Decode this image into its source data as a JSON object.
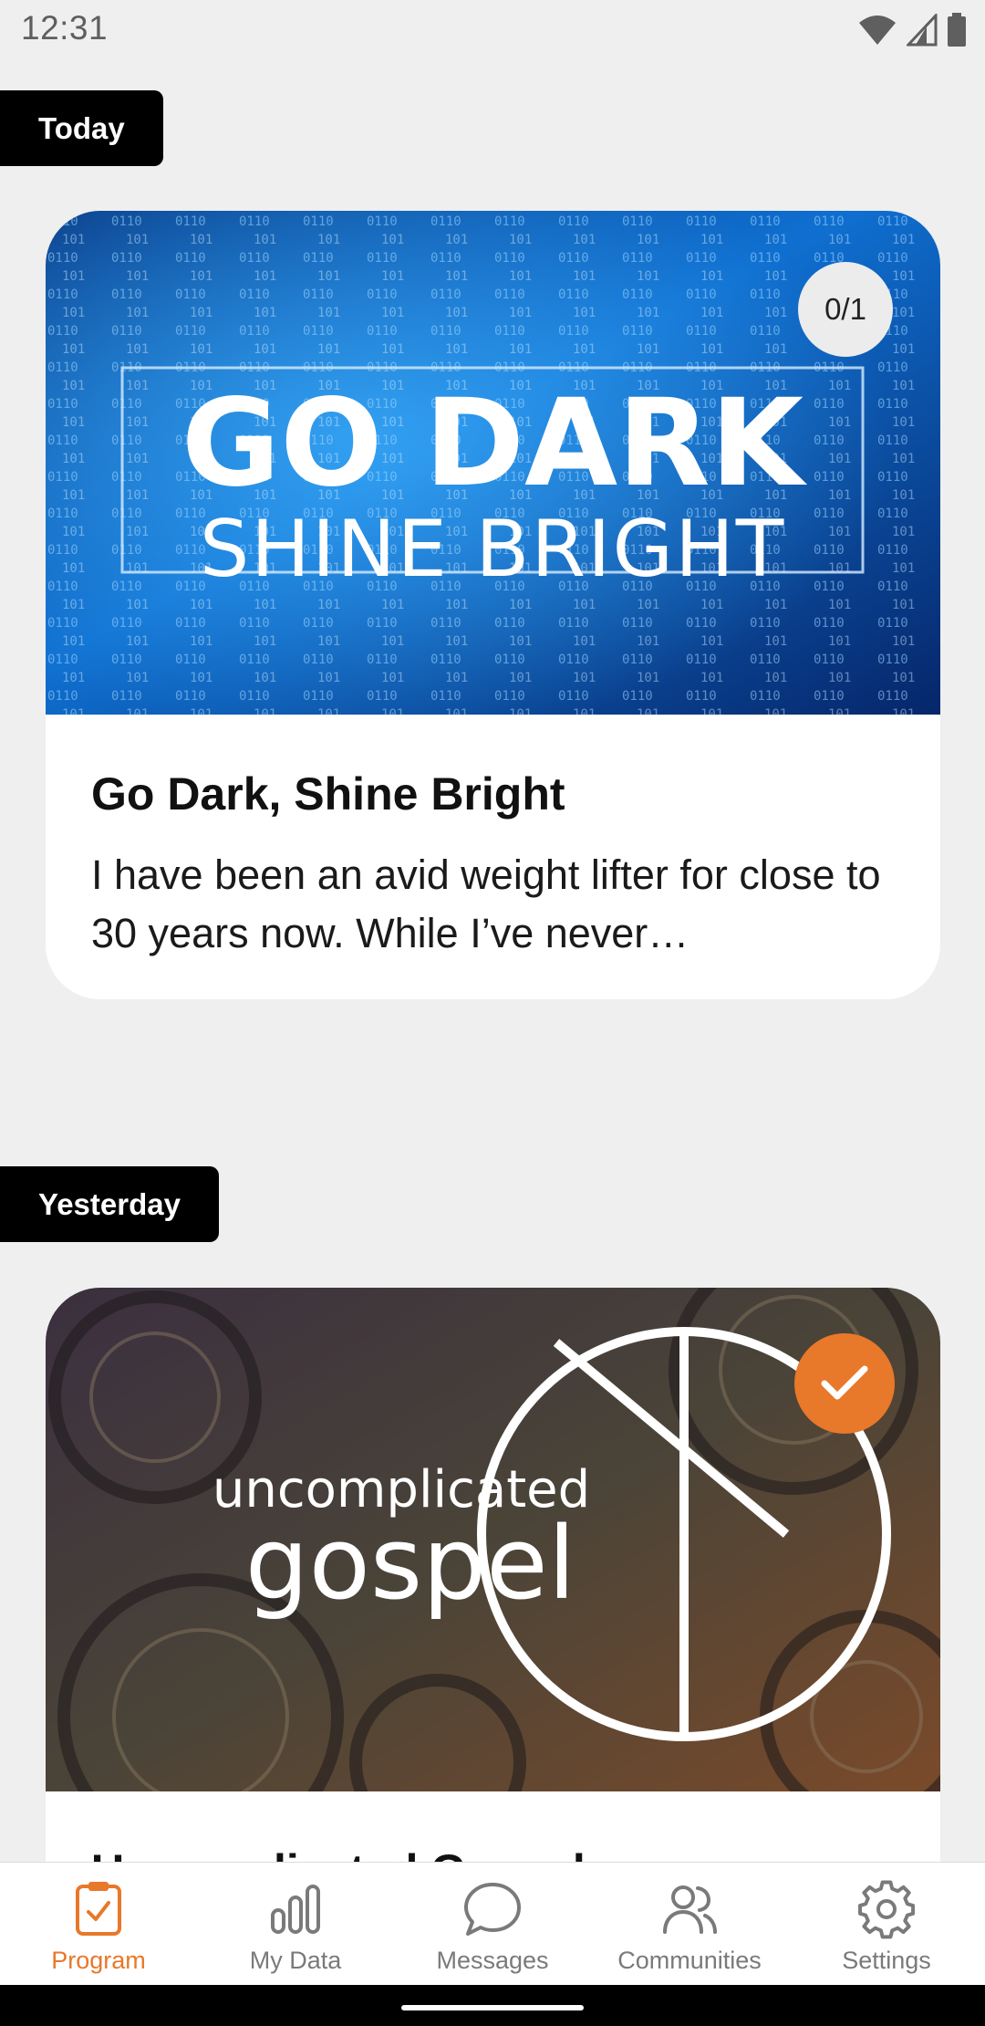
{
  "status_bar": {
    "time": "12:31"
  },
  "sections": [
    {
      "label": "Today",
      "card": {
        "image_title_line1": "GO DARK",
        "image_title_line2": "SHINE BRIGHT",
        "progress": "0/1",
        "title": "Go Dark, Shine Bright",
        "description": "I have been an avid weight lifter for close to 30 years now. While I’ve never…"
      }
    },
    {
      "label": "Yesterday",
      "card": {
        "image_title_line1": "uncomplicated",
        "image_title_line2": "gospel",
        "completed": true,
        "title": "Uncomplicated Gospel"
      }
    }
  ],
  "bottom_nav": {
    "items": [
      {
        "label": "Program",
        "icon": "clipboard-check-icon",
        "active": true
      },
      {
        "label": "My Data",
        "icon": "bar-chart-icon",
        "active": false
      },
      {
        "label": "Messages",
        "icon": "chat-bubble-icon",
        "active": false
      },
      {
        "label": "Communities",
        "icon": "users-icon",
        "active": false
      },
      {
        "label": "Settings",
        "icon": "gear-icon",
        "active": false
      }
    ]
  },
  "colors": {
    "accent": "#e8782a",
    "background": "#efefef",
    "tag_bg": "#000000",
    "nav_inactive": "#7a7a7a"
  }
}
